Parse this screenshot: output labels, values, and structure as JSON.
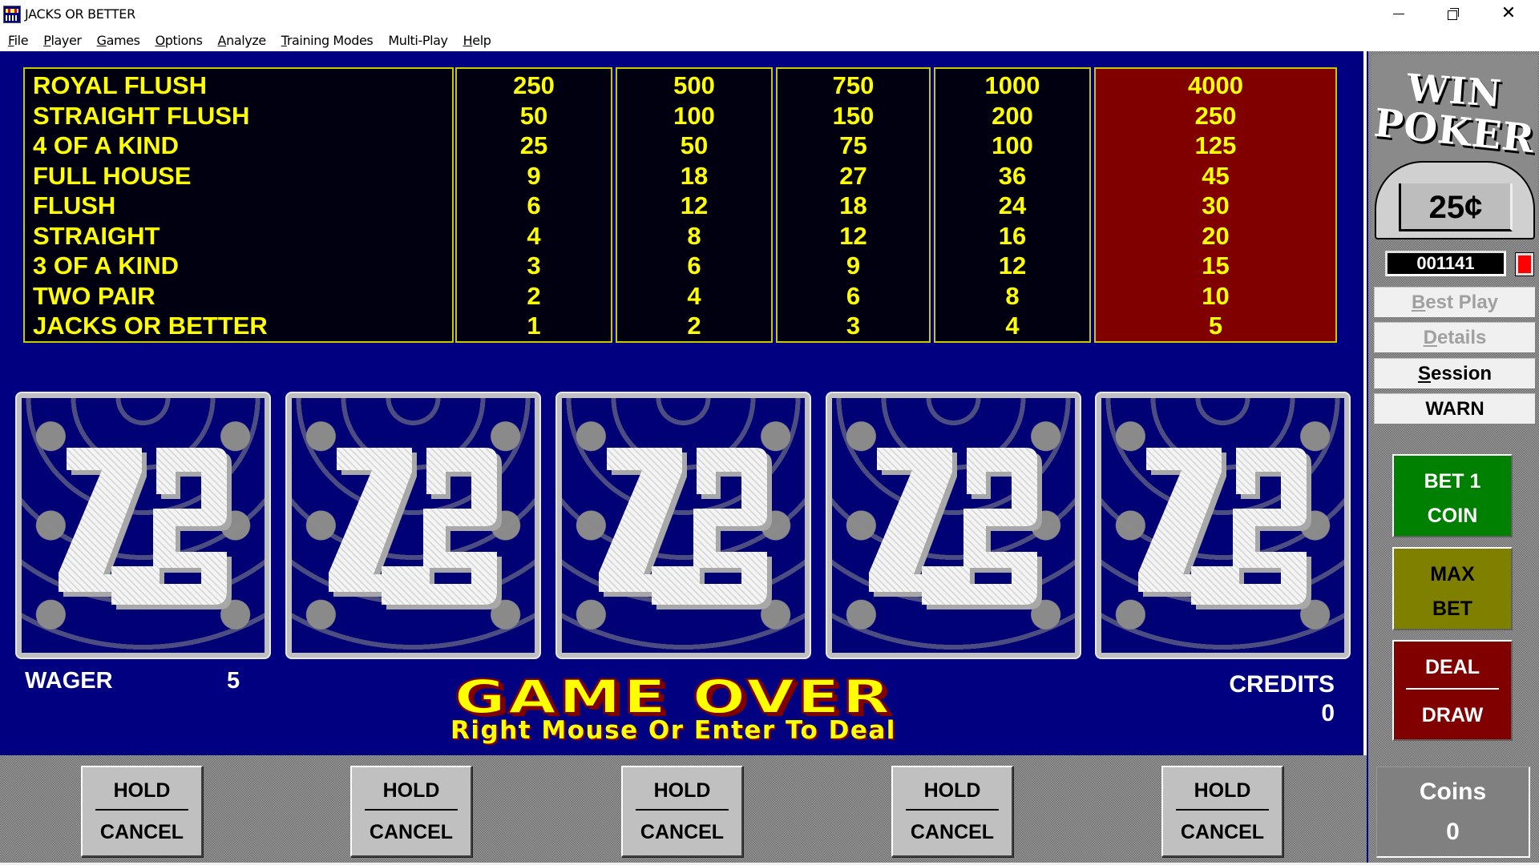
{
  "window": {
    "title": "JACKS OR BETTER",
    "controls": {
      "minimize": "minimize",
      "maximize": "restore",
      "close": "close"
    }
  },
  "menu": [
    {
      "label": "File",
      "accel": "F",
      "rest": "ile"
    },
    {
      "label": "Player",
      "accel": "P",
      "rest": "layer"
    },
    {
      "label": "Games",
      "accel": "G",
      "rest": "ames"
    },
    {
      "label": "Options",
      "accel": "O",
      "rest": "ptions"
    },
    {
      "label": "Analyze",
      "accel": "A",
      "rest": "nalyze"
    },
    {
      "label": "Training Modes",
      "accel": "T",
      "rest": "raining Modes"
    },
    {
      "label": "Multi-Play",
      "accel": "",
      "rest": "Multi-Play"
    },
    {
      "label": "Help",
      "accel": "H",
      "rest": "elp"
    }
  ],
  "paytable": {
    "hands": [
      "ROYAL FLUSH",
      "STRAIGHT FLUSH",
      "4 OF A KIND",
      "FULL HOUSE",
      "FLUSH",
      "STRAIGHT",
      "3 OF A KIND",
      "TWO PAIR",
      "JACKS OR BETTER"
    ],
    "columns": [
      {
        "coins": 1,
        "values": [
          "250",
          "50",
          "25",
          "9",
          "6",
          "4",
          "3",
          "2",
          "1"
        ],
        "highlighted": false
      },
      {
        "coins": 2,
        "values": [
          "500",
          "100",
          "50",
          "18",
          "12",
          "8",
          "6",
          "4",
          "2"
        ],
        "highlighted": false
      },
      {
        "coins": 3,
        "values": [
          "750",
          "150",
          "75",
          "27",
          "18",
          "12",
          "9",
          "6",
          "3"
        ],
        "highlighted": false
      },
      {
        "coins": 4,
        "values": [
          "1000",
          "200",
          "100",
          "36",
          "24",
          "16",
          "12",
          "8",
          "4"
        ],
        "highlighted": false
      },
      {
        "coins": 5,
        "values": [
          "4000",
          "250",
          "125",
          "45",
          "30",
          "20",
          "15",
          "10",
          "5"
        ],
        "highlighted": true
      }
    ]
  },
  "cards": [
    {
      "face": "card-back"
    },
    {
      "face": "card-back"
    },
    {
      "face": "card-back"
    },
    {
      "face": "card-back"
    },
    {
      "face": "card-back"
    }
  ],
  "status": {
    "wager_label": "WAGER",
    "wager_value": "5",
    "credits_label": "CREDITS",
    "credits_value": "0",
    "game_over": "GAME OVER",
    "hint": "Right Mouse Or Enter To Deal"
  },
  "hold_buttons": [
    {
      "hold": "HOLD",
      "cancel": "CANCEL"
    },
    {
      "hold": "HOLD",
      "cancel": "CANCEL"
    },
    {
      "hold": "HOLD",
      "cancel": "CANCEL"
    },
    {
      "hold": "HOLD",
      "cancel": "CANCEL"
    },
    {
      "hold": "HOLD",
      "cancel": "CANCEL"
    }
  ],
  "side_panel": {
    "logo_line1": "WIN",
    "logo_line2": "POKER",
    "denomination": "25¢",
    "counter": "001141",
    "buttons": {
      "best_play": {
        "accel": "B",
        "rest": "est Play",
        "enabled": false
      },
      "details": {
        "accel": "D",
        "rest": "etails",
        "enabled": false
      },
      "session": {
        "accel": "S",
        "rest": "ession",
        "enabled": true
      },
      "warn": {
        "label": "WARN",
        "enabled": true
      }
    },
    "bet_one": {
      "line1": "BET 1",
      "line2": "COIN"
    },
    "max_bet": {
      "line1": "MAX",
      "line2": "BET"
    },
    "deal_draw": {
      "line1": "DEAL",
      "line2": "DRAW"
    },
    "coins_label": "Coins",
    "coins_value": "0"
  },
  "colors": {
    "table_bg": "#000080",
    "paytable_text": "#ffff00",
    "highlight_column": "#800000",
    "bet_one_button": "#008000",
    "max_bet_button": "#808000",
    "deal_button": "#800000"
  }
}
